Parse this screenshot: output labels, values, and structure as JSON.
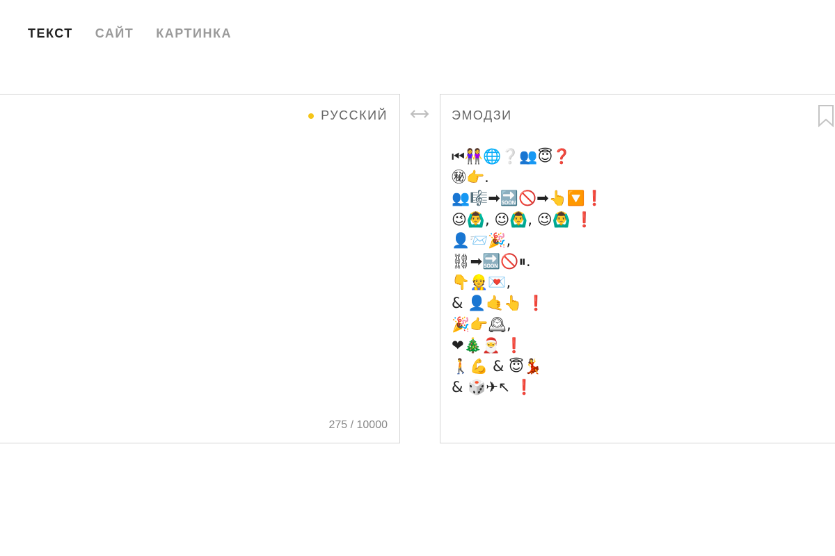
{
  "tabs": [
    {
      "label": "ТЕКСТ",
      "active": true
    },
    {
      "label": "САЙТ",
      "active": false
    },
    {
      "label": "КАРТИНКА",
      "active": false
    }
  ],
  "source": {
    "language": "РУССКИЙ",
    "text": "",
    "counter": "275 / 10000"
  },
  "target": {
    "language": "ЭМОДЗИ",
    "lines": [
      "⏮👭🌐❔👥😇❓",
      "㊙👉.",
      "👥🎼➡🔜🚫➡👆🔽❗",
      "😉🙆‍♂️, 😉🙆‍♂️, 😉🙆‍♂️ ❗",
      "👤📨🎉,",
      "⛓➡🔜🚫⏸.",
      "👇👷💌,",
      "& 👤🤙👆 ❗",
      "🎉👉🕰,",
      "❤🎄🎅 ❗",
      "🚶💪 & 😇💃",
      "& 🎲✈↖ ❗"
    ]
  },
  "colors": {
    "accent_dot": "#f5c518",
    "active_tab": "#222222",
    "inactive_tab": "#9a9a9a"
  },
  "icons": {
    "swap": "swap-arrows-icon",
    "bookmark": "bookmark-icon"
  }
}
